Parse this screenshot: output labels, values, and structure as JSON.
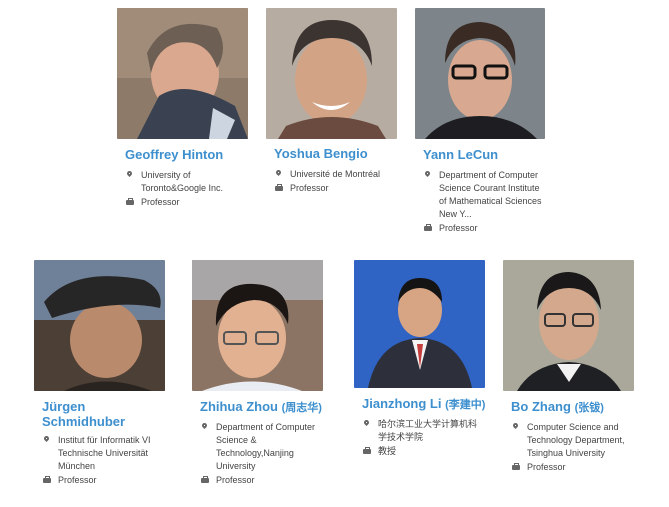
{
  "people": [
    {
      "name": "Geoffrey Hinton",
      "cn": "",
      "affiliation": "University of Toronto&Google Inc.",
      "title": "Professor"
    },
    {
      "name": "Yoshua Bengio",
      "cn": "",
      "affiliation": "Université de Montréal",
      "title": "Professor"
    },
    {
      "name": "Yann LeCun",
      "cn": "",
      "affiliation": "Department of Computer Science Courant Institute of Mathematical Sciences New Y...",
      "title": "Professor"
    },
    {
      "name": "Jürgen Schmidhuber",
      "cn": "",
      "affiliation": "Institut für Informatik VI Technische Universität München",
      "title": "Professor"
    },
    {
      "name": "Zhihua Zhou",
      "cn": "(周志华)",
      "affiliation": "Department of Computer Science & Technology,Nanjing University",
      "title": "Professor"
    },
    {
      "name": "Jianzhong Li",
      "cn": "(李建中)",
      "affiliation": "哈尔滨工业大学计算机科学技术学院",
      "title": "教授"
    },
    {
      "name": "Bo Zhang",
      "cn": "(张钹)",
      "affiliation": "Computer Science and Technology Department, Tsinghua University",
      "title": "Professor"
    }
  ],
  "icons": {
    "location": "map-marker-icon",
    "title": "briefcase-icon"
  },
  "colors": {
    "name": "#3d8fce",
    "text": "#444444"
  }
}
